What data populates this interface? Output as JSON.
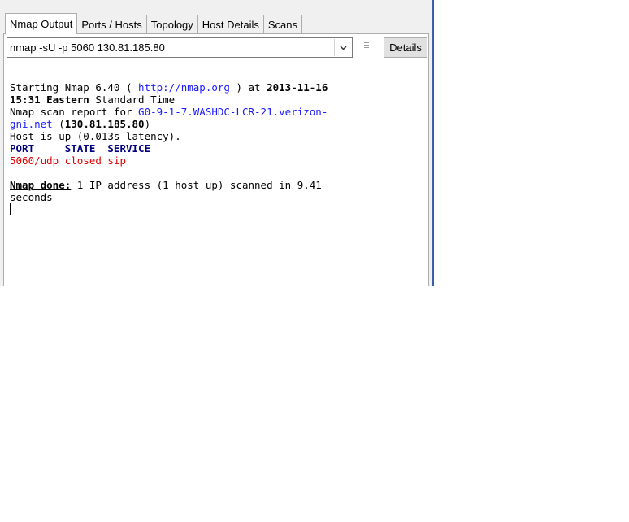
{
  "tabs": [
    {
      "label": "Nmap Output",
      "active": true
    },
    {
      "label": "Ports / Hosts",
      "active": false
    },
    {
      "label": "Topology",
      "active": false
    },
    {
      "label": "Host Details",
      "active": false
    },
    {
      "label": "Scans",
      "active": false
    }
  ],
  "command": {
    "value": "nmap -sU -p 5060 130.81.185.80",
    "details_label": "Details"
  },
  "output": {
    "line1": {
      "prefix": "Starting Nmap 6.40 ( ",
      "url": "http://nmap.org",
      "mid": " ) at ",
      "date": "2013-11-16"
    },
    "line2": {
      "time": "15:31 Eastern",
      "rest": " Standard Time"
    },
    "line3": {
      "prefix": "Nmap scan report for ",
      "host_part1": "G0-9-1-7.WASHDC-LCR-21.verizon-"
    },
    "line4": {
      "host_part2": "gni.net",
      "open": " (",
      "ip": "130.81.185.80",
      "close": ")"
    },
    "line5": "Host is up (0.013s latency).",
    "line6": "PORT     STATE  SERVICE",
    "line7": "5060/udp closed sip",
    "line9": {
      "label": "Nmap done:",
      "rest": " 1 IP address (1 host up) scanned in 9.41"
    },
    "line10": "seconds"
  },
  "colors": {
    "link": "#1a1aff",
    "closed_port": "#e00000",
    "window_border": "#3b5ea8"
  },
  "icons": {
    "combo_arrow": "chevron-down-icon",
    "grip": "grip-icon"
  }
}
